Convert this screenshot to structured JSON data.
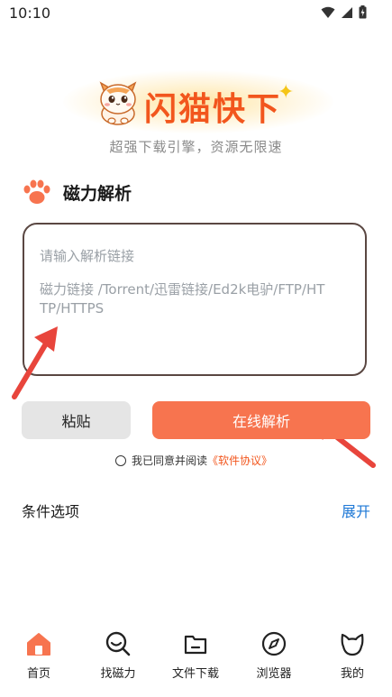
{
  "status_bar": {
    "time": "10:10"
  },
  "brand": {
    "title": "闪猫快下",
    "tagline": "超强下载引擎，资源无限速"
  },
  "section": {
    "title": "磁力解析"
  },
  "input": {
    "placeholder": "请输入解析链接",
    "hint": "磁力链接 /Torrent/迅雷链接/Ed2k电驴/FTP/HTTP/HTTPS"
  },
  "buttons": {
    "paste": "粘贴",
    "parse": "在线解析"
  },
  "agreement": {
    "text": "我已同意并阅读",
    "link": "《软件协议》"
  },
  "options": {
    "label": "条件选项",
    "expand": "展开"
  },
  "tabs": [
    {
      "label": "首页",
      "icon": "home-icon",
      "active": true
    },
    {
      "label": "找磁力",
      "icon": "search-icon"
    },
    {
      "label": "文件下载",
      "icon": "folder-icon"
    },
    {
      "label": "浏览器",
      "icon": "compass-icon"
    },
    {
      "label": "我的",
      "icon": "cat-face-icon"
    }
  ],
  "colors": {
    "accent": "#f7744f",
    "brand": "#f2561d",
    "link": "#1e78d6",
    "arrow": "#e8453c"
  }
}
